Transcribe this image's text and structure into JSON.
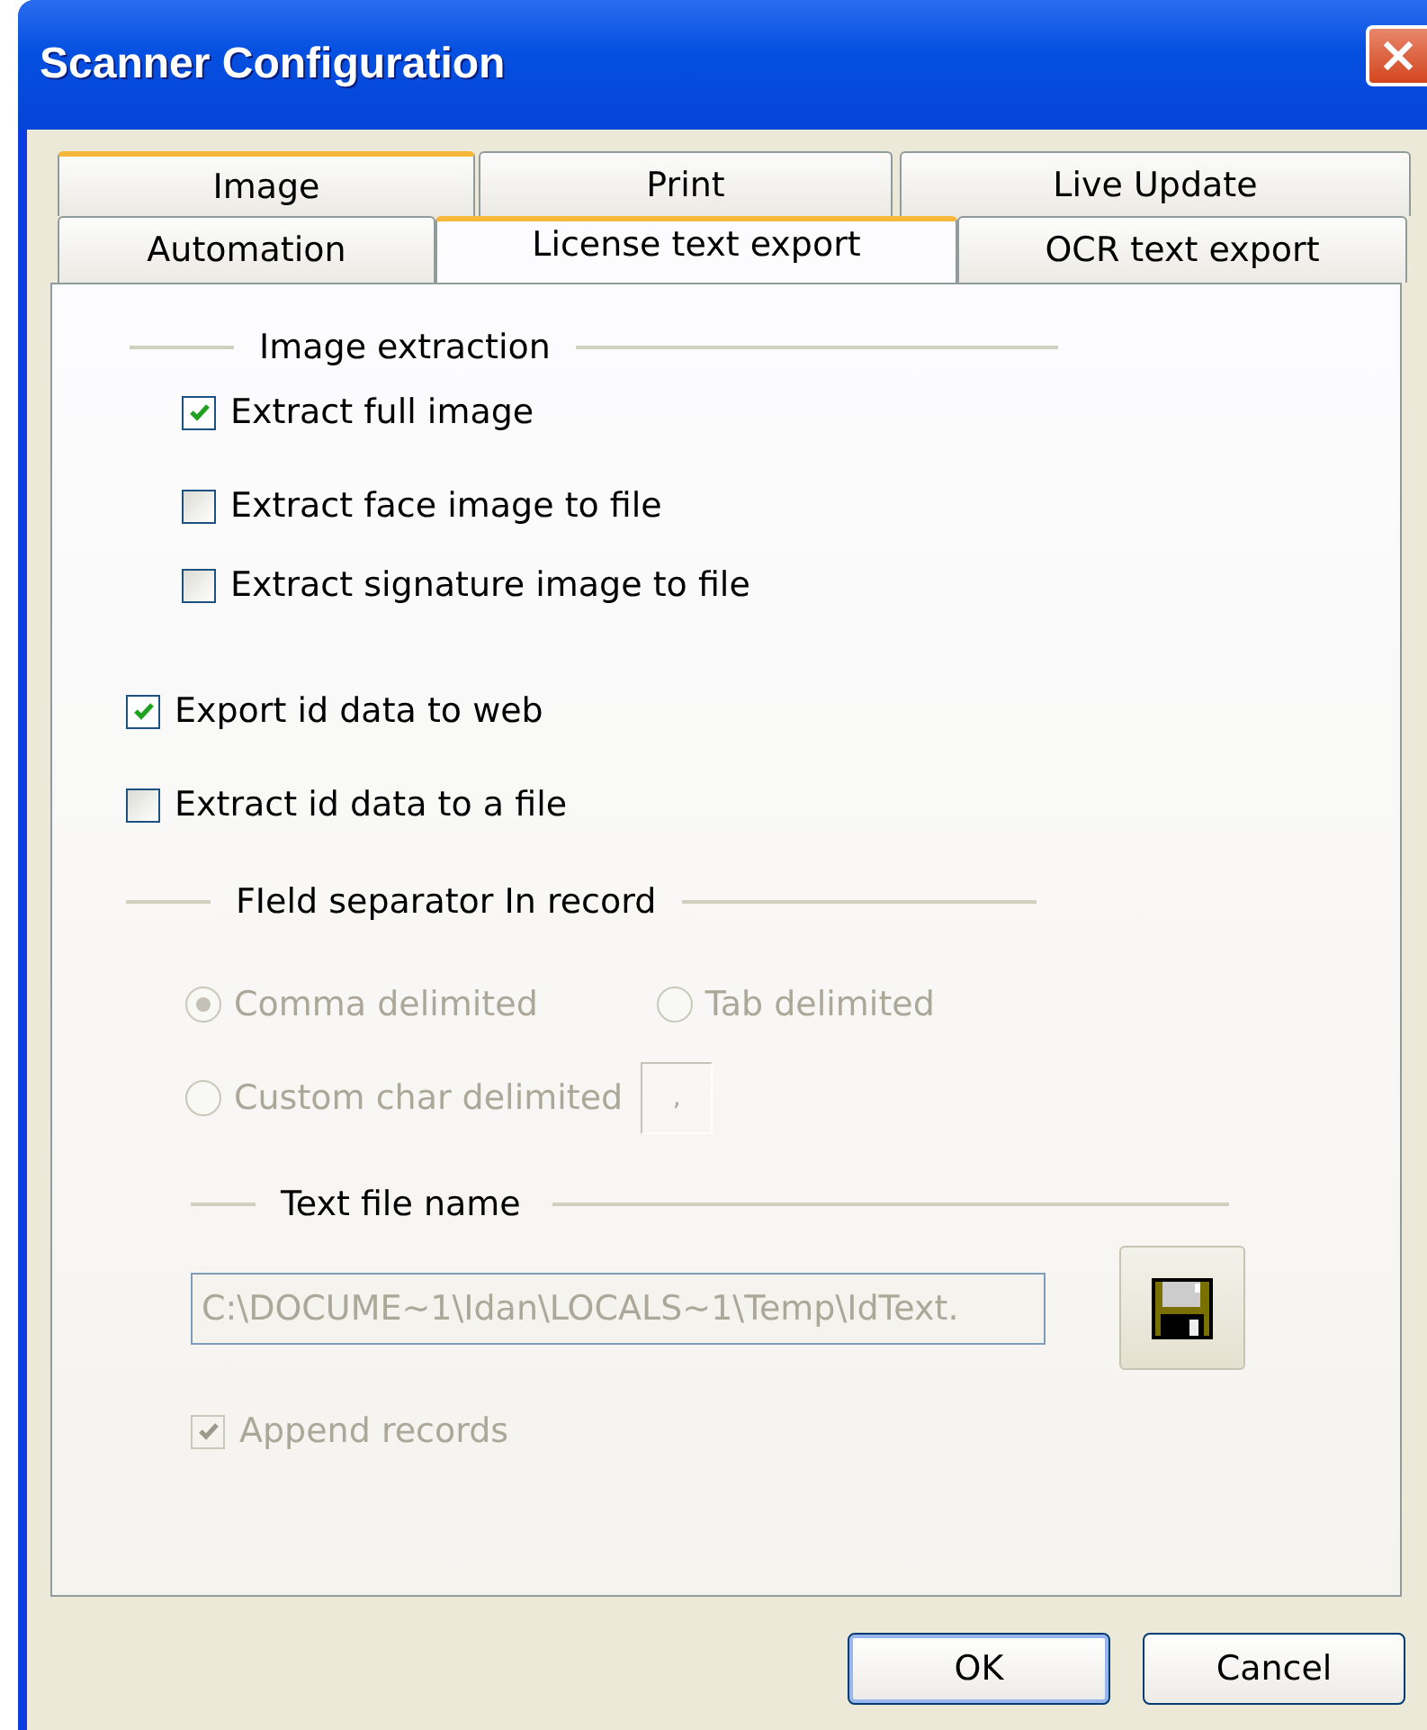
{
  "window": {
    "title": "Scanner Configuration"
  },
  "tab_rows": [
    [
      {
        "label": "Image",
        "selected": false,
        "hot": true
      },
      {
        "label": "Print",
        "selected": false,
        "hot": false
      },
      {
        "label": "Live Update",
        "selected": false,
        "hot": false
      }
    ],
    [
      {
        "label": "Automation",
        "selected": false,
        "hot": false
      },
      {
        "label": "License text export",
        "selected": true,
        "hot": true
      },
      {
        "label": "OCR text export",
        "selected": false,
        "hot": false
      }
    ]
  ],
  "image_extraction": {
    "title": "Image extraction",
    "options": [
      {
        "label": "Extract full image",
        "checked": true
      },
      {
        "label": "Extract face image to file",
        "checked": false
      },
      {
        "label": "Extract signature image to file",
        "checked": false
      }
    ]
  },
  "id_data_options": [
    {
      "label": "Export id data to web",
      "checked": true
    },
    {
      "label": "Extract id data to a file",
      "checked": false
    }
  ],
  "field_separator": {
    "title": "FIeld separator In record",
    "disabled": true,
    "radios": [
      {
        "label": "Comma delimited",
        "selected": true
      },
      {
        "label": "Tab delimited",
        "selected": false
      },
      {
        "label": "Custom char delimited",
        "selected": false
      }
    ],
    "custom_char": ","
  },
  "text_file": {
    "title": "Text file name",
    "value": "C:\\DOCUME~1\\Idan\\LOCALS~1\\Temp\\IdText.",
    "disabled": true
  },
  "append_records": {
    "label": "Append records",
    "checked": true,
    "disabled": true
  },
  "buttons": [
    {
      "label": "OK",
      "default": true
    },
    {
      "label": "Cancel",
      "default": false
    }
  ]
}
